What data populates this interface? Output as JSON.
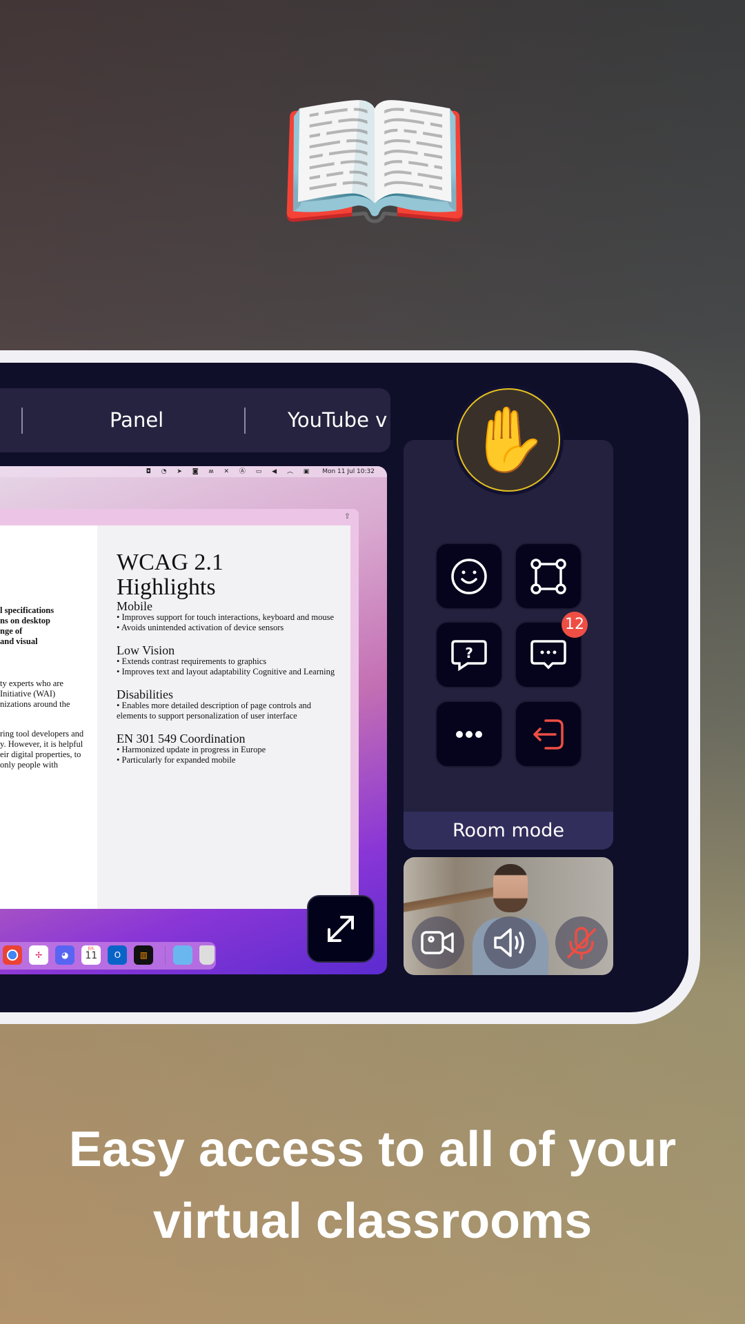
{
  "tabs": {
    "items": [
      {
        "label": "Panel"
      },
      {
        "label": "YouTube v"
      }
    ]
  },
  "shared_screen": {
    "menubar": {
      "datetime": "Mon 11 Jul  10:32"
    },
    "document": {
      "left_fragments": [
        "l specifications",
        "ns on desktop",
        "nge of",
        " and visual",
        "ty experts who are",
        " Initiative (WAI)",
        "nizations around the",
        "ring tool developers and",
        "y. However, it is helpful",
        "eir digital properties, to",
        " only people with"
      ],
      "title": "WCAG 2.1 Highlights",
      "sections": [
        {
          "heading": "Mobile",
          "bullets": [
            "• Improves support for touch interactions, keyboard and mouse",
            "• Avoids unintended activation of device sensors"
          ]
        },
        {
          "heading": "Low Vision",
          "bullets": [
            "• Extends contrast requirements to graphics",
            "• Improves text and layout adaptability Cognitive and Learning"
          ]
        },
        {
          "heading": "Disabilities",
          "bullets": [
            "• Enables more detailed description of page controls and elements to support personalization of user interface"
          ]
        },
        {
          "heading": "EN 301 549 Coordination",
          "bullets": [
            "• Harmonized update in progress in Europe",
            "• Particularly for expanded mobile"
          ]
        }
      ],
      "dock_calendar": {
        "month": "JUL",
        "day": "11"
      }
    }
  },
  "controls": {
    "raise_hand_icon": "raised-hand",
    "buttons": [
      "smile-icon",
      "whiteboard-icon",
      "question-icon",
      "chat-icon",
      "more-icon",
      "leave-icon"
    ],
    "chat_badge": "12",
    "room_mode_label": "Room mode"
  },
  "colors": {
    "accent_yellow": "#e6c21f",
    "danger": "#ee4e44",
    "panel": "#23213d",
    "room_mode_bar": "#322e5c"
  },
  "headline": {
    "line1": "Easy access to all of your",
    "line2": "virtual classrooms"
  }
}
